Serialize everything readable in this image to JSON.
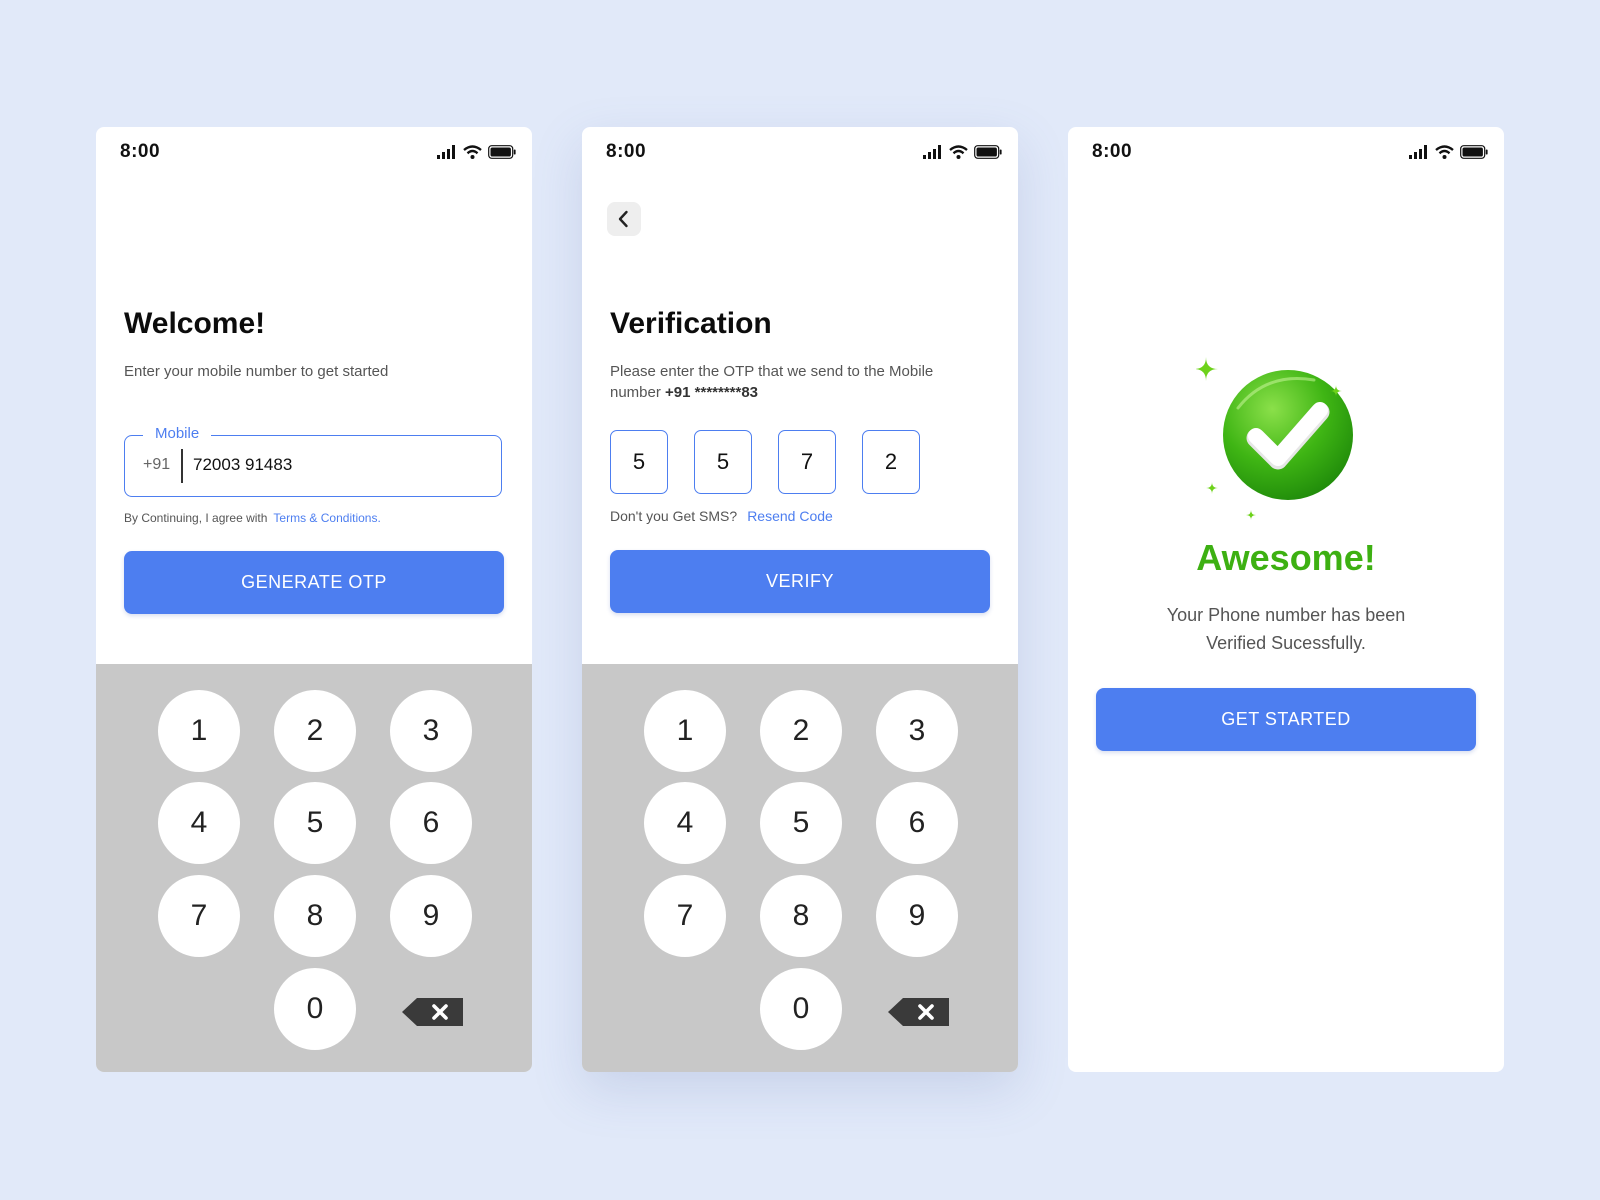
{
  "status_bar": {
    "time": "8:00"
  },
  "colors": {
    "accent": "#4d7ef0",
    "success": "#3db012",
    "keypad_bg": "#c8c8c8",
    "page_bg": "#e1e9f9"
  },
  "login": {
    "title": "Welcome!",
    "subtitle": "Enter your mobile number to get started",
    "mobile_label": "Mobile",
    "country_code": "+91",
    "mobile_value": "72003 91483",
    "terms_prefix": "By Continuing, I agree with",
    "terms_link": "Terms & Conditions.",
    "button": "GENERATE OTP"
  },
  "verify": {
    "title": "Verification",
    "subtitle": "Please enter the OTP that we send to the Mobile number",
    "masked_number": "+91 ********83",
    "otp": [
      "5",
      "5",
      "7",
      "2"
    ],
    "resend_prefix": "Don't you Get SMS?",
    "resend_link": "Resend Code",
    "button": "VERIFY"
  },
  "success": {
    "title": "Awesome!",
    "message_line1": "Your Phone number has been",
    "message_line2": "Verified Sucessfully.",
    "button": "GET STARTED"
  },
  "keypad": {
    "keys": [
      "1",
      "2",
      "3",
      "4",
      "5",
      "6",
      "7",
      "8",
      "9",
      "0"
    ],
    "backspace_icon": "backspace-icon"
  }
}
